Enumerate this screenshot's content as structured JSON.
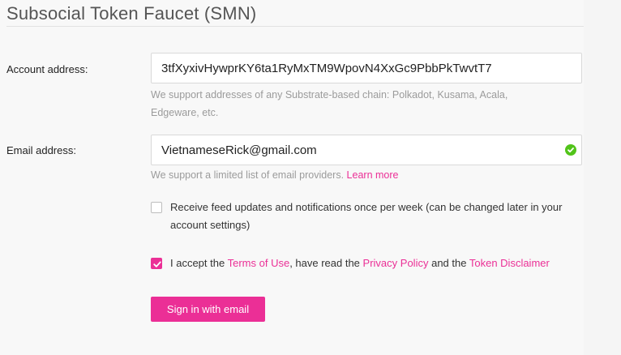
{
  "header": {
    "title": "Subsocial Token Faucet (SMN)"
  },
  "form": {
    "account": {
      "label": "Account address:",
      "value": "3tfXyxivHywprKY6ta1RyMxTM9WpovN4XxGc9PbbPkTwvtT7",
      "help": "We support addresses of any Substrate-based chain: Polkadot, Kusama, Acala, Edgeware, etc."
    },
    "email": {
      "label": "Email address:",
      "value": "VietnameseRick@gmail.com",
      "help_prefix": "We support a limited list of email providers.",
      "help_link": "Learn more",
      "status_icon": "check-circle-icon"
    },
    "feed": {
      "checked": false,
      "text": "Receive feed updates and notifications once per week (can be changed later in your account settings)"
    },
    "terms": {
      "checked": true,
      "prefix": "I accept the",
      "terms_link": "Terms of Use",
      "middle": ", have read the",
      "privacy_link": "Privacy Policy",
      "and": "and the",
      "disclaimer_link": "Token Disclaimer"
    },
    "submit_label": "Sign in with email"
  },
  "colors": {
    "accent": "#eb2f96",
    "success": "#52c41a",
    "muted": "#9b9b9b"
  }
}
